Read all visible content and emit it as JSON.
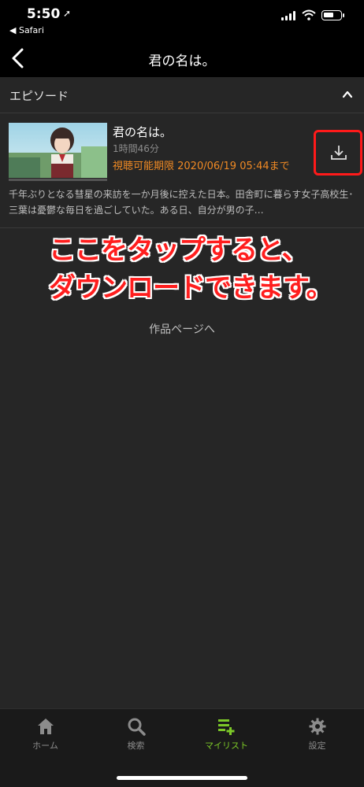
{
  "status_bar": {
    "time": "5:50",
    "back_app": "◀ Safari"
  },
  "nav": {
    "title": "君の名は。"
  },
  "section": {
    "title": "エピソード"
  },
  "episode": {
    "title": "君の名は。",
    "duration": "1時間46分",
    "expiry": "視聴可能期限 2020/06/19 05:44まで",
    "description": "千年ぶりとなる彗星の来訪を一か月後に控えた日本。田舎町に暮らす女子高校生･三葉は憂鬱な毎日を過ごしていた。ある日、自分が男の子…"
  },
  "annotation": {
    "line1": "ここをタップすると、",
    "line2": "ダウンロードできます。"
  },
  "work_link": "作品ページへ",
  "tabs": [
    {
      "label": "ホーム",
      "icon": "home-icon",
      "active": false
    },
    {
      "label": "検索",
      "icon": "search-icon",
      "active": false
    },
    {
      "label": "マイリスト",
      "icon": "mylist-icon",
      "active": true
    },
    {
      "label": "設定",
      "icon": "gear-icon",
      "active": false
    }
  ],
  "colors": {
    "accent_green": "#7cc828",
    "expiry_orange": "#f08a24",
    "highlight_red": "#ff1a1a"
  }
}
